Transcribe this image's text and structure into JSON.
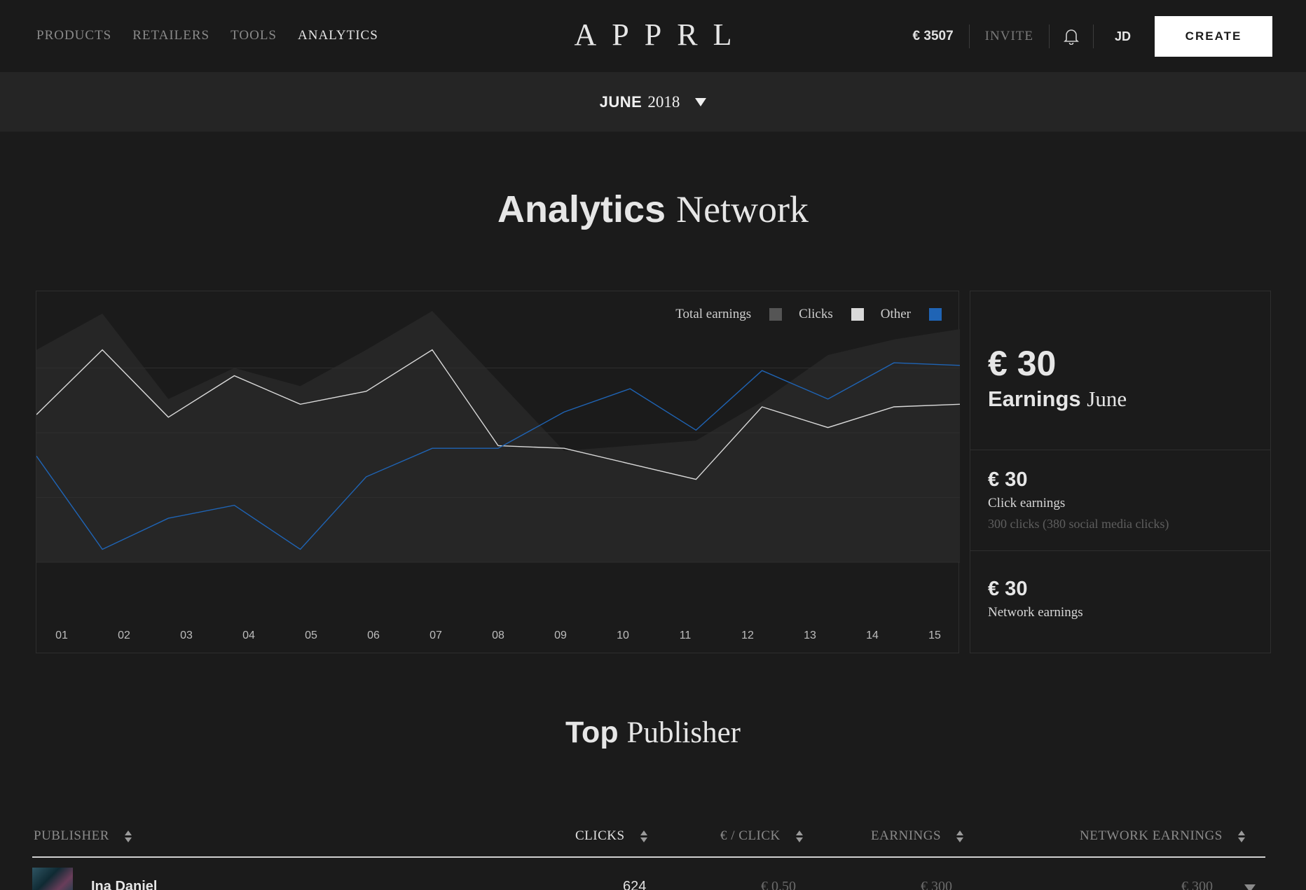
{
  "nav": {
    "items": [
      "PRODUCTS",
      "RETAILERS",
      "TOOLS",
      "ANALYTICS"
    ],
    "active": "ANALYTICS",
    "logo": "APPRL",
    "balance": "€ 3507",
    "invite": "INVITE",
    "initials": "JD",
    "create_label": "CREATE"
  },
  "month_selector": {
    "month": "JUNE",
    "year": "2018"
  },
  "analytics_title": {
    "bold": "Analytics",
    "serif": "Network"
  },
  "chart_data": {
    "type": "line",
    "categories": [
      "01",
      "02",
      "03",
      "04",
      "05",
      "06",
      "07",
      "08",
      "09",
      "10",
      "11",
      "12",
      "13",
      "14",
      "15"
    ],
    "ylim": [
      0,
      100
    ],
    "grid": true,
    "legend_position": "top-right",
    "series": [
      {
        "name": "Total earnings",
        "type": "area",
        "color": "#555555",
        "values": [
          82,
          96,
          63,
          75,
          68,
          82,
          97,
          70,
          43,
          45,
          47,
          62,
          80,
          86,
          90
        ]
      },
      {
        "name": "Clicks",
        "type": "line",
        "color": "#d9d9d9",
        "values": [
          57,
          82,
          56,
          72,
          61,
          66,
          82,
          45,
          44,
          38,
          32,
          60,
          52,
          60,
          61
        ]
      },
      {
        "name": "Other",
        "type": "line",
        "color": "#1f64b5",
        "values": [
          41,
          5,
          17,
          22,
          5,
          33,
          44,
          44,
          58,
          67,
          51,
          74,
          63,
          77,
          76
        ]
      }
    ]
  },
  "stats": {
    "main": {
      "amount": "€ 30",
      "label_bold": "Earnings",
      "label_serif": "June"
    },
    "click": {
      "amount": "€ 30",
      "label": "Click earnings",
      "sub": "300 clicks (380 social media clicks)"
    },
    "network": {
      "amount": "€ 30",
      "label": "Network earnings"
    }
  },
  "publisher_title": {
    "bold": "Top",
    "serif": "Publisher"
  },
  "table": {
    "headers": {
      "publisher": "PUBLISHER",
      "clicks": "CLICKS",
      "per_click": "€ / CLICK",
      "earnings": "EARNINGS",
      "network_earnings": "NETWORK EARNINGS"
    },
    "rows": [
      {
        "name": "Ina Daniel",
        "clicks": "624",
        "per_click": "€ 0.50",
        "earnings": "€ 300",
        "network_earnings": "€ 300"
      }
    ]
  }
}
